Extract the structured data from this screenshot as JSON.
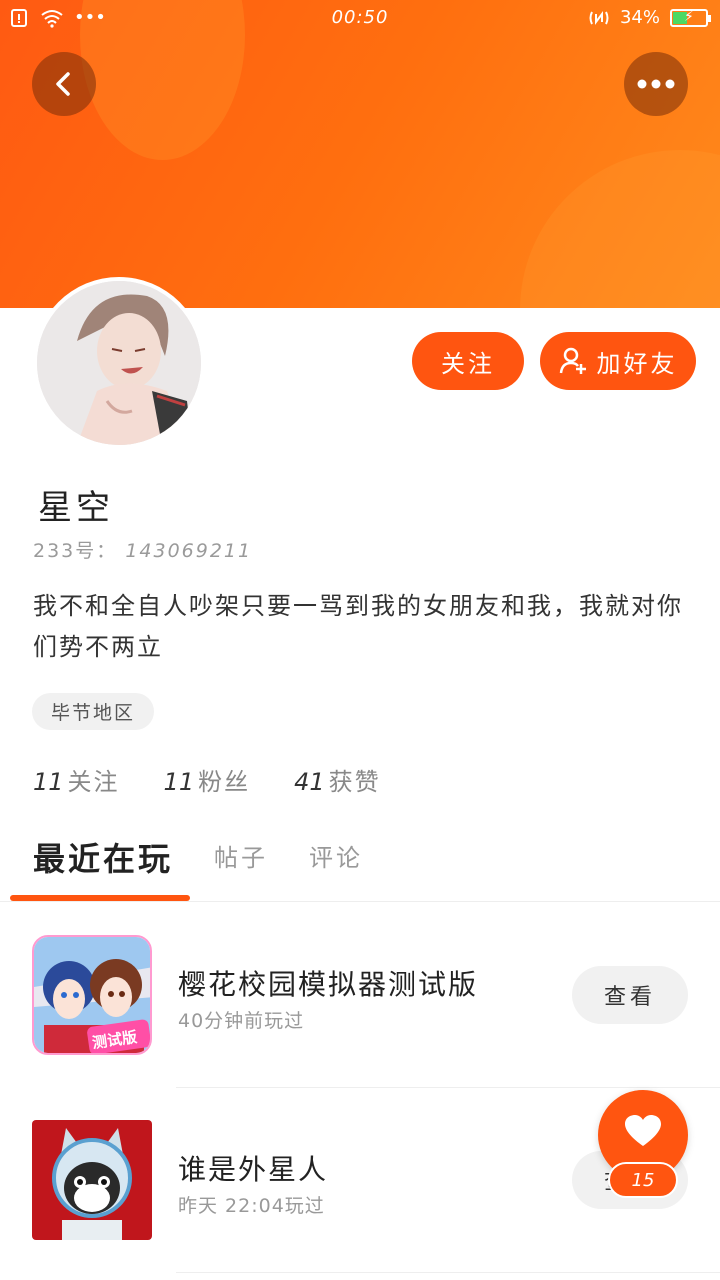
{
  "status_bar": {
    "time": "00:50",
    "battery": "34%",
    "dots": "•••"
  },
  "profile": {
    "username": "星空",
    "uid_label": "233号：",
    "uid": "143069211",
    "bio": "我不和全自人吵架只要一骂到我的女朋友和我，我就对你们势不两立",
    "region": "毕节地区",
    "follow_button": "关注",
    "add_friend_button": "加好友"
  },
  "stats": [
    {
      "value": "11",
      "label": "关注"
    },
    {
      "value": "11",
      "label": "粉丝"
    },
    {
      "value": "41",
      "label": "获赞"
    }
  ],
  "tabs": [
    {
      "label": "最近在玩"
    },
    {
      "label": "帖子"
    },
    {
      "label": "评论"
    }
  ],
  "games": [
    {
      "title": "樱花校园模拟器测试版",
      "subtitle": "40分钟前玩过",
      "badge": "测试版",
      "action": "查看"
    },
    {
      "title": "谁是外星人",
      "subtitle": "昨天 22:04玩过",
      "action": "查看"
    }
  ],
  "like": {
    "count": "15"
  },
  "colors": {
    "accent": "#ff5510",
    "header": "#ff6f0f"
  },
  "icons": [
    "back-icon",
    "more-icon",
    "add-user-icon",
    "heart-icon",
    "wifi-icon",
    "battery-icon",
    "nfc-icon"
  ]
}
